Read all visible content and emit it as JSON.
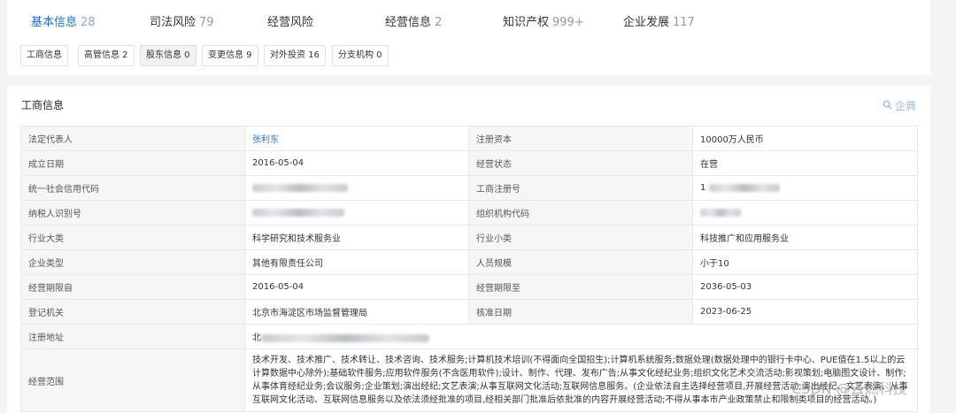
{
  "tabs": [
    {
      "label": "基本信息",
      "count": "28"
    },
    {
      "label": "司法风险",
      "count": "79"
    },
    {
      "label": "经营风险",
      "count": ""
    },
    {
      "label": "经营信息",
      "count": "2"
    },
    {
      "label": "知识产权",
      "count": "999+"
    },
    {
      "label": "企业发展",
      "count": "117"
    }
  ],
  "subtabs": [
    "工商信息",
    "高管信息 2",
    "股东信息 0",
    "变更信息 9",
    "对外投资 16",
    "分支机构 0"
  ],
  "section": {
    "title": "工商信息",
    "brand": "企典"
  },
  "rows": [
    {
      "l1": "法定代表人",
      "v1": "张利东",
      "l2": "注册资本",
      "v2": "10000万人民币"
    },
    {
      "l1": "成立日期",
      "v1": "2016-05-04",
      "l2": "经营状态",
      "v2": "在营"
    },
    {
      "l1": "统一社会信用代码",
      "v1": "",
      "l2": "工商注册号",
      "v2": "1"
    },
    {
      "l1": "纳税人识别号",
      "v1": "",
      "l2": "组织机构代码",
      "v2": ""
    },
    {
      "l1": "行业大类",
      "v1": "科学研究和技术服务业",
      "l2": "行业小类",
      "v2": "科技推广和应用服务业"
    },
    {
      "l1": "企业类型",
      "v1": "其他有限责任公司",
      "l2": "人员规模",
      "v2": "小于10"
    },
    {
      "l1": "经营期限自",
      "v1": "2016-05-04",
      "l2": "经营期限至",
      "v2": "2036-05-03"
    },
    {
      "l1": "登记机关",
      "v1": "北京市海淀区市场监督管理局",
      "l2": "核准日期",
      "v2": "2023-06-25"
    }
  ],
  "address": {
    "label": "注册地址",
    "value": "北"
  },
  "scope": {
    "label": "经营范围",
    "value": "技术开发、技术推广、技术转让、技术咨询、技术服务;计算机技术培训(不得面向全国招生);计算机系统服务;数据处理(数据处理中的银行卡中心、PUE值在1.5以上的云计算数据中心除外);基础软件服务;应用软件服务(不含医用软件);设计、制作、代理、发布广告;从事文化经纪业务;组织文化艺术交流活动;影视策划;电脑图文设计、制作;从事体育经纪业务;会议服务;企业策划;演出经纪;文艺表演;从事互联网文化活动;互联网信息服务。(企业依法自主选择经营项目,开展经营活动;演出经纪、文艺表演、从事互联网文化活动、互联网信息服务以及依法须经批准的项目,经相关部门批准后依批准的内容开展经营活动;不得从事本市产业政策禁止和限制类项目的经营活动。)"
  },
  "watermark": "CSDN @云燃科技"
}
